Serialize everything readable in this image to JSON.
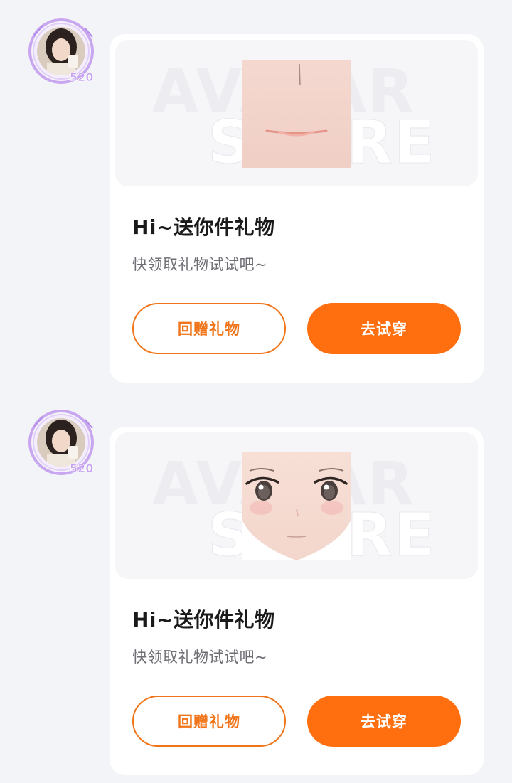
{
  "colors": {
    "accent": "#ff6f0f",
    "outline_accent": "#f0751a",
    "page_background": "#f3f4f8",
    "card_background": "#ffffff"
  },
  "messages": [
    {
      "sender_avatar_icon": "user-avatar-with-purple-frame",
      "preview_watermark": [
        "AVATAR",
        "STORE"
      ],
      "item_icon": "mouth-face-part",
      "title": "Hi~送你件礼物",
      "subtitle": "快领取礼物试试吧~",
      "return_gift_label": "回赠礼物",
      "try_on_label": "去试穿"
    },
    {
      "sender_avatar_icon": "user-avatar-with-purple-frame",
      "preview_watermark": [
        "AVATAR",
        "STORE"
      ],
      "item_icon": "anime-eyes-face-part",
      "title": "Hi~送你件礼物",
      "subtitle": "快领取礼物试试吧~",
      "return_gift_label": "回赠礼物",
      "try_on_label": "去试穿"
    }
  ]
}
